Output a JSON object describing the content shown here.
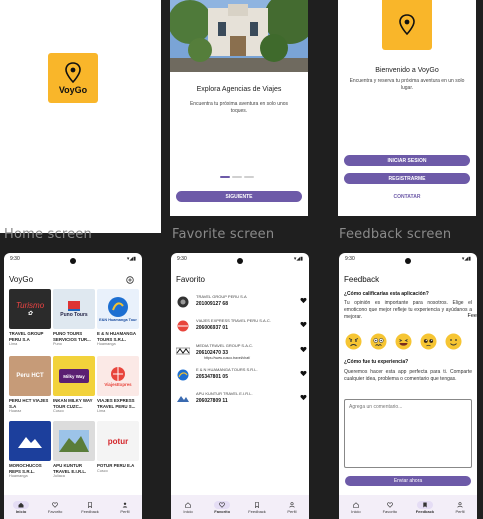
{
  "screens": {
    "splash": {
      "logo_text": "VoyGo"
    },
    "onboarding": {
      "title": "Explora Agencias de Viajes",
      "description": "Encuentra tu próxima aventura en solo unos toques.",
      "next_button": "SIGUIENTE"
    },
    "welcome": {
      "title": "Bienvenido a VoyGo",
      "description": "Encuentra y reserva tu próxima aventura en un solo lugar.",
      "login_button": "INICIAR SESION",
      "register_button": "REGISTRARME",
      "contact_link": "CONTATAR"
    },
    "home": {
      "time": "9:30",
      "title": "VoyGo",
      "agencies": [
        {
          "name": "TRAVEL GROUP PERU S.A",
          "city": "Lima",
          "color": "#2b2b2b"
        },
        {
          "name": "PUNO TOURS SERVICIOS TUR...",
          "city": "Puno",
          "color": "#dfe8f0"
        },
        {
          "name": "E & N HUAMANGA TOURS S.R.L.",
          "city": "Huamanga",
          "color": "#e9f1fb"
        },
        {
          "name": "PERU HCT VIAJES S.A",
          "city": "Huaraz",
          "color": "#c69b78"
        },
        {
          "name": "INKAN MILKY WAY TOUR CUZC...",
          "city": "Cusco",
          "color": "#f2d23b"
        },
        {
          "name": "VIAJES EXPRESS TRAVEL PERU S...",
          "city": "Lima",
          "color": "#fbe9e6"
        },
        {
          "name": "MOROCHUCOS REPS S.R.L.",
          "city": "Huamanga",
          "color": "#1c3f9c"
        },
        {
          "name": "APU KUNTUR TRAVEL E.I.R.L.",
          "city": "Juliaca",
          "color": "#dcdcdc"
        },
        {
          "name": "POTUR PERU E.A",
          "city": "Cusco",
          "color": "#f4f4f4"
        }
      ],
      "logo_words": {
        "turismo": "Turismo",
        "puno_tours": "Puno Tours",
        "huamanga": "E&N Huamanga Tour",
        "peru_hct": "Peru HCT",
        "milky_way": "Milky Way",
        "viajes_express": "ViajesExpres",
        "potur": "potur"
      }
    },
    "favorite": {
      "time": "9:30",
      "title": "Favorito",
      "items": [
        {
          "name": "TRAVEL GROUP PERU S.A",
          "phone": "201009127 68",
          "url": ""
        },
        {
          "name": "VIAJES EXPRESS TRAVEL PERU S.A.C.",
          "phone": "206006937 01",
          "url": ""
        },
        {
          "name": "MEDIA TRAVEL GROUP S.A.C.",
          "phone": "206102470 33",
          "url": "https://www.cusco.travel/chat/"
        },
        {
          "name": "E & N HUAMANGA TOURS S.R.L.",
          "phone": "205347801 05",
          "url": ""
        },
        {
          "name": "APU KUNTUR TRAVEL E.I.R.L.",
          "phone": "206027809 11",
          "url": ""
        }
      ]
    },
    "feedback": {
      "time": "9:30",
      "title": "Feedback",
      "q1": "¿Cómo calificarías esta aplicación?",
      "q1_text": "Tu opinión es importante para nosotros. Elige el emoticono que mejor refleje tu experiencia y ayúdanos a mejorar.",
      "q2": "¿Cómo fue tu experiencia?",
      "q2_text": "Queremos hacer esta app perfecta para ti. Comparte cualquier idea, problema o comentario que tengas.",
      "comment_placeholder": "Agrega un comentario...",
      "send_button": "Enviar ahora",
      "overflow_text": "Fee"
    }
  },
  "captions": {
    "home": "Home screen",
    "favorite": "Favorite screen",
    "feedback": "Feedback  screen"
  },
  "nav": {
    "home": "Inicio",
    "favorite": "Favorito",
    "feedback": "Feedback",
    "profile": "Perfil"
  }
}
